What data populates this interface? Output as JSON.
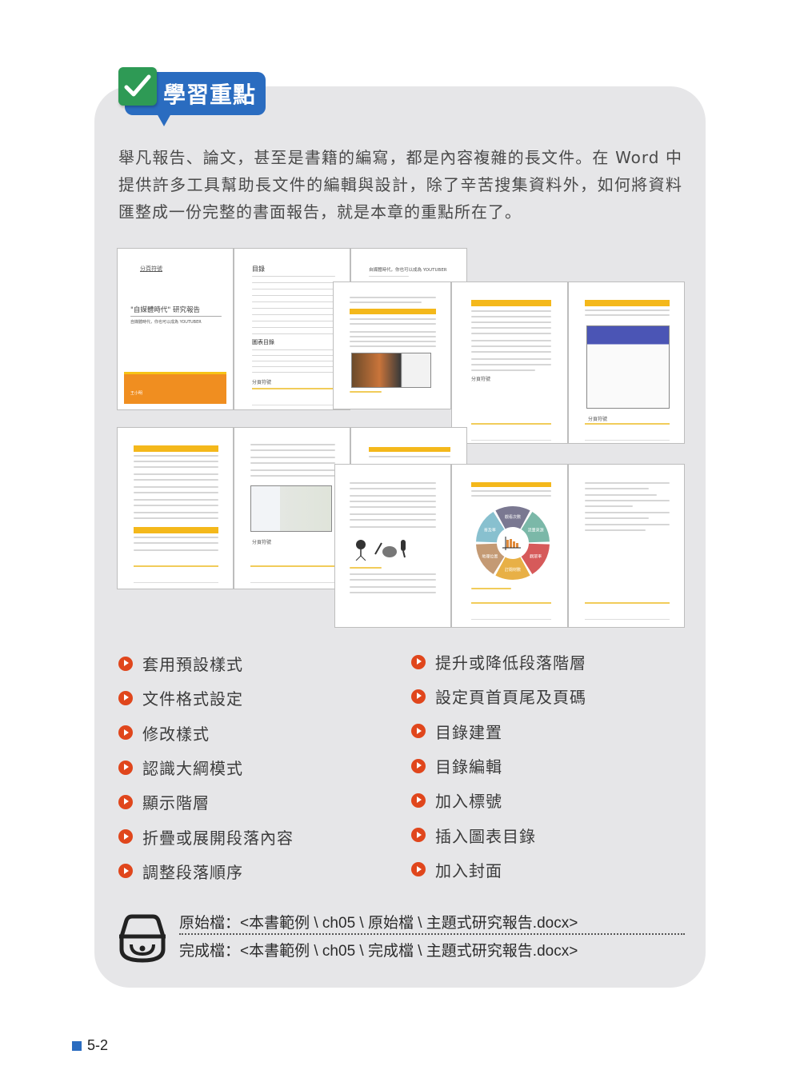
{
  "badge": {
    "title": "學習重點",
    "icon": "checkmark-icon"
  },
  "intro": {
    "text": "舉凡報告、論文，甚至是書籍的編寫，都是內容複雜的長文件。在 Word 中提供許多工具幫助長文件的編輯與設計，除了辛苦搜集資料外，如何將資料匯整成一份完整的書面報告，就是本章的重點所在了。"
  },
  "thumbnails": {
    "cover": {
      "section_break": "分頁符號",
      "title": "\"自媒體時代\" 研究報告",
      "subtitle": "自媒體時代，你也可以成為 YOUTUBER",
      "author": "王小明"
    },
    "toc": {
      "heading": "目錄",
      "figures_heading": "圖表目錄",
      "section_break": "分頁符號"
    },
    "chapter": {
      "heading": "自媒體時代，你也可以成為 YOUTUBER"
    },
    "page_break_label": "分頁符號",
    "wheel": {
      "segments": [
        {
          "label": "觀看次數",
          "color": "#7a7891"
        },
        {
          "label": "流量來源",
          "color": "#7bb8a8"
        },
        {
          "label": "觀眾率",
          "color": "#d65a5a"
        },
        {
          "label": "訂閱材數",
          "color": "#e8b046"
        },
        {
          "label": "地理位置",
          "color": "#c49a74"
        },
        {
          "label": "普及率",
          "color": "#88c0cf"
        }
      ],
      "bar_color": "#e08a3a"
    }
  },
  "bullets_left": [
    "套用預設樣式",
    "文件格式設定",
    "修改樣式",
    "認識大綱模式",
    "顯示階層",
    "折疊或展開段落內容",
    "調整段落順序"
  ],
  "bullets_right": [
    "提升或降低段落階層",
    "設定頁首頁尾及頁碼",
    "目錄建置",
    "目錄編輯",
    "加入標號",
    "插入圖表目錄",
    "加入封面"
  ],
  "files": {
    "icon": "disc-drive-icon",
    "original": "原始檔：<本書範例 \\ ch05 \\ 原始檔 \\ 主題式研究報告.docx>",
    "finished": "完成檔：<本書範例 \\ ch05 \\ 完成檔 \\ 主題式研究報告.docx>"
  },
  "page_number": "5-2",
  "colors": {
    "accent_blue": "#2a6cc0",
    "check_green": "#2e9a55",
    "bullet_orange": "#e0461c",
    "panel_gray": "#e6e6e8",
    "highlight_yellow": "#f4b81b"
  }
}
